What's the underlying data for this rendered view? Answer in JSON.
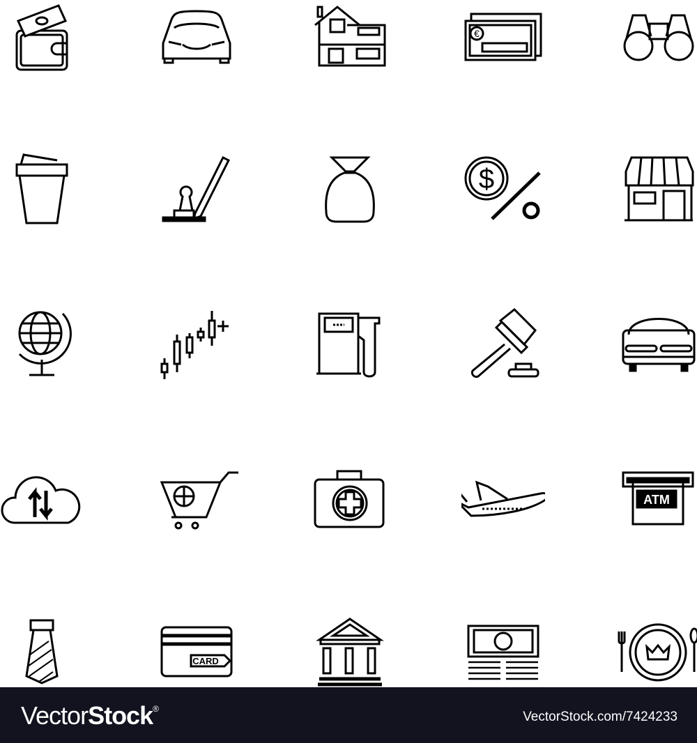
{
  "icons": [
    {
      "name": "wallet-money-icon"
    },
    {
      "name": "car-icon"
    },
    {
      "name": "house-icon"
    },
    {
      "name": "euro-cheque-icon"
    },
    {
      "name": "binoculars-icon"
    },
    {
      "name": "trash-bin-icon"
    },
    {
      "name": "stamp-pen-icon"
    },
    {
      "name": "money-bag-icon"
    },
    {
      "name": "dollar-percent-icon"
    },
    {
      "name": "shop-icon"
    },
    {
      "name": "globe-icon"
    },
    {
      "name": "candlestick-chart-icon"
    },
    {
      "name": "gas-pump-icon"
    },
    {
      "name": "auction-gavel-icon"
    },
    {
      "name": "bed-icon"
    },
    {
      "name": "cloud-transfer-icon"
    },
    {
      "name": "global-shopping-cart-icon"
    },
    {
      "name": "first-aid-kit-icon"
    },
    {
      "name": "airplane-icon"
    },
    {
      "name": "atm-icon"
    },
    {
      "name": "necktie-icon"
    },
    {
      "name": "credit-card-icon"
    },
    {
      "name": "bank-icon"
    },
    {
      "name": "banknote-stack-icon"
    },
    {
      "name": "fine-dining-icon"
    }
  ],
  "icon_text": {
    "euro": "€",
    "dollar": "$",
    "atm": "ATM",
    "card": "CARD"
  },
  "footer": {
    "brand_light": "Vector",
    "brand_bold": "Stock",
    "registered": "®",
    "url": "VectorStock.com/7424233"
  },
  "colors": {
    "icon_stroke": "#000000",
    "background": "#ffffff",
    "footer_bg": "#12131f",
    "footer_text": "#ffffff"
  }
}
